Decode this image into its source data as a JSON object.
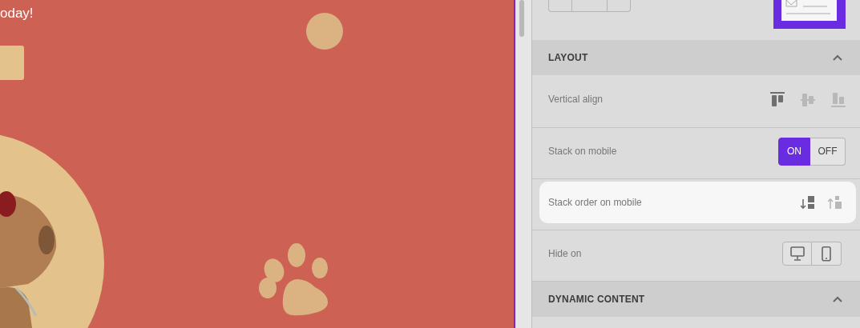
{
  "canvas": {
    "heading": "oday!"
  },
  "panel": {
    "sections": [
      {
        "title": "LAYOUT",
        "expanded": true,
        "rows": [
          {
            "kind": "align",
            "label": "Vertical align",
            "hovered": false,
            "options": [
              {
                "kind": "top",
                "selected": true
              },
              {
                "kind": "middle",
                "selected": false
              },
              {
                "kind": "bottom",
                "selected": false
              }
            ]
          },
          {
            "kind": "toggle",
            "label": "Stack on mobile",
            "hovered": false,
            "options": [
              {
                "label": "ON",
                "selected": true
              },
              {
                "label": "OFF",
                "selected": false
              }
            ]
          },
          {
            "kind": "order",
            "label": "Stack order on mobile",
            "hovered": true,
            "options": [
              {
                "kind": "down",
                "selected": true
              },
              {
                "kind": "up",
                "selected": false
              }
            ]
          },
          {
            "kind": "devices",
            "label": "Hide on",
            "hovered": false,
            "options": [
              {
                "kind": "desktop",
                "selected": false
              },
              {
                "kind": "mobile",
                "selected": false
              }
            ]
          }
        ]
      },
      {
        "title": "DYNAMIC CONTENT",
        "expanded": true
      }
    ]
  }
}
